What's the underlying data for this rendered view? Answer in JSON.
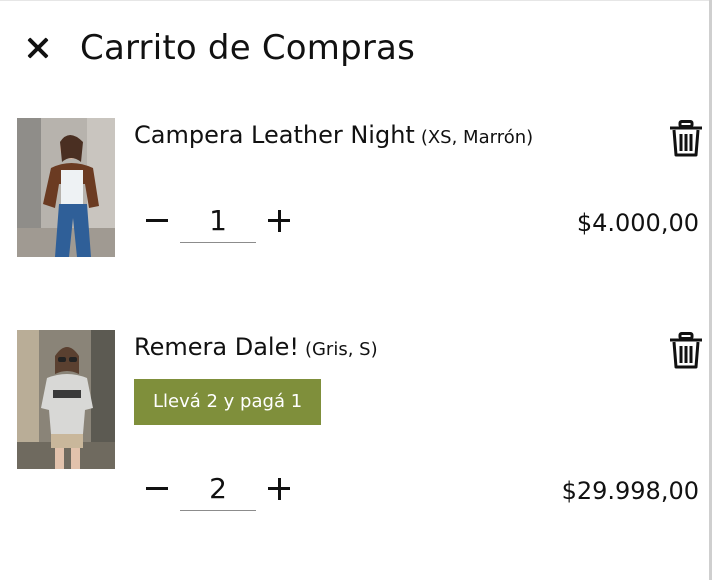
{
  "header": {
    "close_icon": "close-icon",
    "title": "Carrito de Compras"
  },
  "items": [
    {
      "name": "Campera Leather Night",
      "variant": "(XS, Marrón)",
      "promo": "",
      "quantity": "1",
      "price": "$4.000,00",
      "image_description": "woman in brown leather jacket and jeans",
      "delete_icon": "trash-icon"
    },
    {
      "name": "Remera Dale!",
      "variant": "(Gris, S)",
      "promo": "Llevá 2 y pagá 1",
      "quantity": "2",
      "price": "$29.998,00",
      "image_description": "woman in grey t-shirt with sunglasses",
      "delete_icon": "trash-icon"
    }
  ],
  "colors": {
    "promo_badge": "#7f8f3b",
    "text": "#111111",
    "background": "#ffffff"
  }
}
